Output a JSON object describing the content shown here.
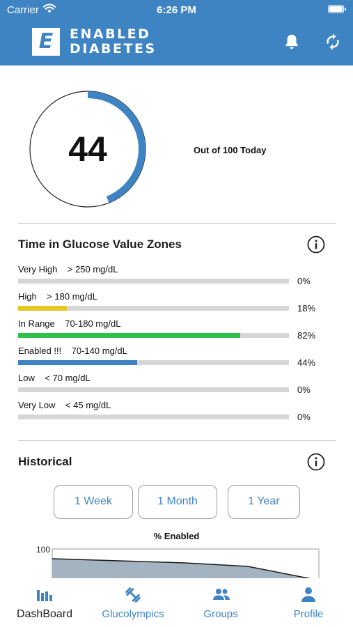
{
  "status_bar": {
    "carrier": "Carrier",
    "time": "6:26 PM"
  },
  "header": {
    "logo_letter": "E",
    "logo_line1": "ENABLED",
    "logo_line2": "DIABETES",
    "icons": [
      "bell-icon",
      "sync-icon"
    ]
  },
  "score": {
    "value": "44",
    "max": 100,
    "caption": "Out of 100 Today"
  },
  "zones": {
    "title": "Time in Glucose Value Zones",
    "items": [
      {
        "label": "Very High    > 250 mg/dL",
        "percent": "0%",
        "fraction": 0.0,
        "color": "#d6d6d6"
      },
      {
        "label": "High    > 180 mg/dL",
        "percent": "18%",
        "fraction": 0.18,
        "color": "#e3c920"
      },
      {
        "label": "In Range    70-180 mg/dL",
        "percent": "82%",
        "fraction": 0.82,
        "color": "#2ec24a"
      },
      {
        "label": "Enabled !!!    70-140 mg/dL",
        "percent": "44%",
        "fraction": 0.44,
        "color": "#3f84c2"
      },
      {
        "label": "Low    < 70 mg/dL",
        "percent": "0%",
        "fraction": 0.0,
        "color": "#d6d6d6"
      },
      {
        "label": "Very Low    < 45 mg/dL",
        "percent": "0%",
        "fraction": 0.0,
        "color": "#d6d6d6"
      }
    ]
  },
  "historical": {
    "title": "Historical",
    "ranges": [
      "1 Week",
      "1 Month",
      "1 Year"
    ]
  },
  "chart_data": {
    "type": "area",
    "title": "% Enabled",
    "ylim": [
      0,
      100
    ],
    "y_ticks": [
      "100"
    ],
    "x": [
      0,
      1,
      2,
      3
    ],
    "values": [
      86,
      80,
      75,
      55
    ]
  },
  "tab_bar": {
    "tabs": [
      {
        "label": "DashBoard",
        "icon": "dashboard-icon",
        "active": true
      },
      {
        "label": "Glucolympics",
        "icon": "dumbbell-icon",
        "active": false
      },
      {
        "label": "Groups",
        "icon": "groups-icon",
        "active": false
      },
      {
        "label": "Profile",
        "icon": "profile-icon",
        "active": false
      }
    ]
  },
  "colors": {
    "brand": "#3f84c2",
    "active_tab": "#1c1c1c",
    "inactive_tab": "#3f84c2"
  }
}
